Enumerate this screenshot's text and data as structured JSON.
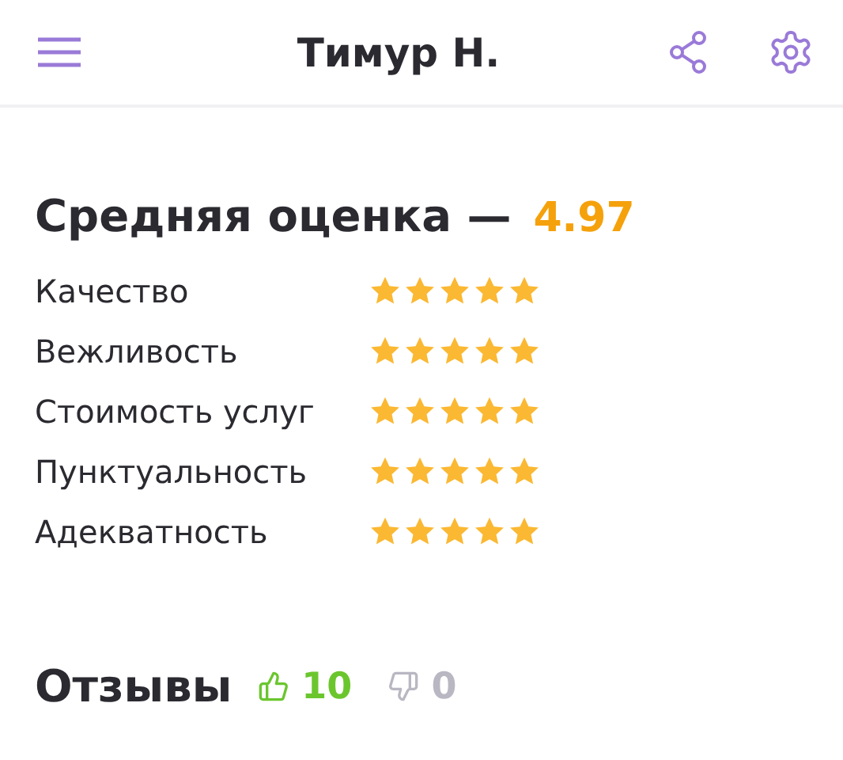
{
  "header": {
    "title": "Тимур Н."
  },
  "rating": {
    "title": "Средняя оценка —",
    "average": "4.97",
    "criteria": [
      {
        "label": "Качество",
        "stars": 5
      },
      {
        "label": "Вежливость",
        "stars": 5
      },
      {
        "label": "Стоимость услуг",
        "stars": 5
      },
      {
        "label": "Пунктуальность",
        "stars": 5
      },
      {
        "label": "Адекватность",
        "stars": 5
      }
    ]
  },
  "reviews": {
    "title": "Отзывы",
    "likes": "10",
    "dislikes": "0"
  }
}
